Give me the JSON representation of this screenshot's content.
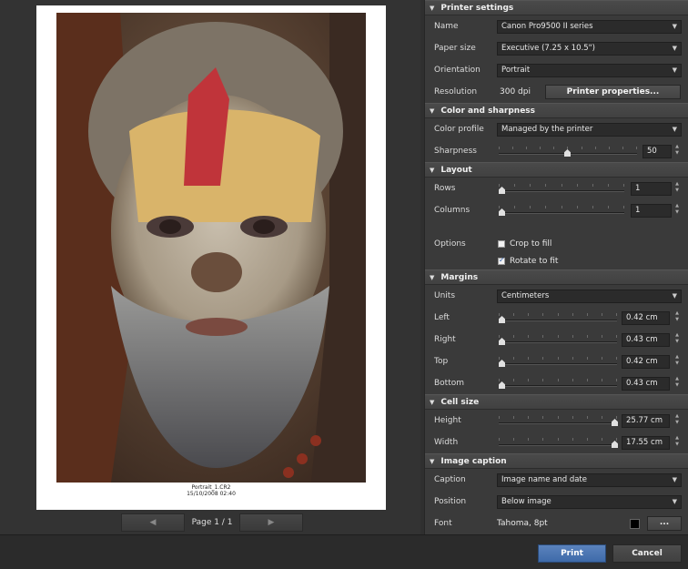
{
  "preview": {
    "caption_line1": "Portrait_1.CR2",
    "caption_line2": "15/10/2008 02:40",
    "prev_icon": "◀",
    "next_icon": "▶",
    "page_label": "Page 1 / 1"
  },
  "printer": {
    "header": "Printer settings",
    "name_label": "Name",
    "name_value": "Canon Pro9500 II series",
    "paper_label": "Paper size",
    "paper_value": "Executive (7.25 x 10.5\")",
    "orientation_label": "Orientation",
    "orientation_value": "Portrait",
    "resolution_label": "Resolution",
    "resolution_value": "300 dpi",
    "properties_button": "Printer properties..."
  },
  "color": {
    "header": "Color and sharpness",
    "profile_label": "Color profile",
    "profile_value": "Managed by the printer",
    "sharpness_label": "Sharpness",
    "sharpness_value": "50",
    "sharpness_fraction": 0.5
  },
  "layout": {
    "header": "Layout",
    "rows_label": "Rows",
    "rows_value": "1",
    "columns_label": "Columns",
    "columns_value": "1",
    "options_label": "Options",
    "crop_label": "Crop to fill",
    "crop_checked": false,
    "rotate_label": "Rotate to fit",
    "rotate_checked": true
  },
  "margins": {
    "header": "Margins",
    "units_label": "Units",
    "units_value": "Centimeters",
    "left_label": "Left",
    "left_value": "0.42 cm",
    "right_label": "Right",
    "right_value": "0.43 cm",
    "top_label": "Top",
    "top_value": "0.42 cm",
    "bottom_label": "Bottom",
    "bottom_value": "0.43 cm"
  },
  "cell": {
    "header": "Cell size",
    "height_label": "Height",
    "height_value": "25.77 cm",
    "width_label": "Width",
    "width_value": "17.55 cm"
  },
  "caption": {
    "header": "Image caption",
    "caption_label": "Caption",
    "caption_value": "Image name and date",
    "position_label": "Position",
    "position_value": "Below image",
    "font_label": "Font",
    "font_value": "Tahoma, 8pt",
    "color_swatch": "#000000",
    "font_button": "..."
  },
  "footer": {
    "print_button": "Print",
    "cancel_button": "Cancel"
  },
  "icons": {
    "collapse": "▼",
    "dropdown": "▼",
    "spin_up": "▲",
    "spin_down": "▼"
  }
}
